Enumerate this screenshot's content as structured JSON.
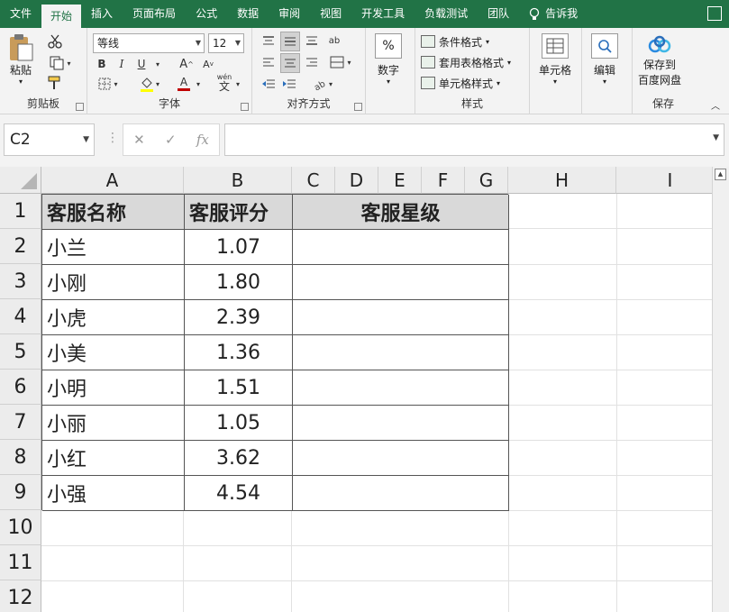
{
  "tabs": [
    "文件",
    "开始",
    "插入",
    "页面布局",
    "公式",
    "数据",
    "审阅",
    "视图",
    "开发工具",
    "负载测试",
    "团队"
  ],
  "tell_me": "告诉我",
  "ribbon": {
    "clipboard": {
      "paste": "粘贴",
      "label": "剪贴板"
    },
    "font": {
      "name": "等线",
      "size": "12",
      "bold": "B",
      "italic": "I",
      "underline": "U",
      "grow": "A",
      "shrink": "A",
      "color_a": "A",
      "wen": "wén",
      "wen_char": "文",
      "label": "字体"
    },
    "alignment": {
      "ab": "ab",
      "label": "对齐方式"
    },
    "number": {
      "percent": "%",
      "name": "数字"
    },
    "styles": {
      "conditional": "条件格式",
      "table": "套用表格格式",
      "cell": "单元格样式",
      "label": "样式"
    },
    "cells": {
      "name": "单元格"
    },
    "editing": {
      "name": "编辑"
    },
    "save": {
      "name_line1": "保存到",
      "name_line2": "百度网盘",
      "label": "保存"
    }
  },
  "formula_bar": {
    "name_box": "C2",
    "cancel": "✕",
    "enter": "✓",
    "fx": "fx",
    "formula": ""
  },
  "columns": [
    "A",
    "B",
    "C",
    "D",
    "E",
    "F",
    "G",
    "H",
    "I"
  ],
  "rows": [
    "1",
    "2",
    "3",
    "4",
    "5",
    "6",
    "7",
    "8",
    "9",
    "10",
    "11",
    "12"
  ],
  "table": {
    "headers": [
      "客服名称",
      "客服评分",
      "客服星级"
    ],
    "rows": [
      {
        "name": "小兰",
        "score": "1.07",
        "stars": ""
      },
      {
        "name": "小刚",
        "score": "1.80",
        "stars": ""
      },
      {
        "name": "小虎",
        "score": "2.39",
        "stars": ""
      },
      {
        "name": "小美",
        "score": "1.36",
        "stars": ""
      },
      {
        "name": "小明",
        "score": "1.51",
        "stars": ""
      },
      {
        "name": "小丽",
        "score": "1.05",
        "stars": ""
      },
      {
        "name": "小红",
        "score": "3.62",
        "stars": ""
      },
      {
        "name": "小强",
        "score": "4.54",
        "stars": ""
      }
    ]
  },
  "colors": {
    "brand": "#217346",
    "header_fill": "#d9d9d9"
  }
}
